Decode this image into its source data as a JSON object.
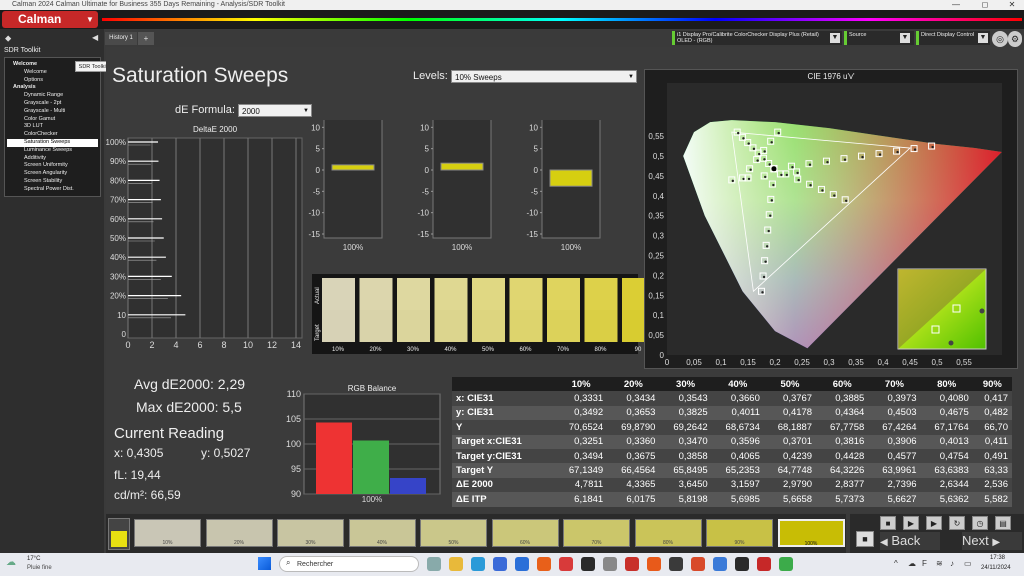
{
  "window": {
    "title": "Calman 2024 Calman Ultimate for Business 355 Days Remaining - Analysis/SDR Toolkit",
    "minimize": "—",
    "maximize": "◻",
    "close": "✕"
  },
  "app": {
    "logo": "Calman"
  },
  "sidebar": {
    "title": "SDR Toolkit",
    "tooltip": "SDR Toolkit",
    "items": [
      {
        "label": "Welcome",
        "level": 0
      },
      {
        "label": "Welcome",
        "level": 1
      },
      {
        "label": "Options",
        "level": 1
      },
      {
        "label": "Analysis",
        "level": 0
      },
      {
        "label": "Dynamic Range",
        "level": 1
      },
      {
        "label": "Grayscale - 2pt",
        "level": 1
      },
      {
        "label": "Grayscale - Multi",
        "level": 1
      },
      {
        "label": "Color Gamut",
        "level": 1
      },
      {
        "label": "3D LUT",
        "level": 1
      },
      {
        "label": "ColorChecker",
        "level": 1
      },
      {
        "label": "Saturation Sweeps",
        "level": 1,
        "selected": true
      },
      {
        "label": "Luminance Sweeps",
        "level": 1
      },
      {
        "label": "Additivity",
        "level": 1
      },
      {
        "label": "Screen Uniformity",
        "level": 1
      },
      {
        "label": "Screen Angularity",
        "level": 1
      },
      {
        "label": "Screen Stability",
        "level": 1
      },
      {
        "label": "Spectral Power Dist.",
        "level": 1
      }
    ]
  },
  "tabs": {
    "history": "History 1",
    "add": "+"
  },
  "devices": {
    "meter_line1": "i1 Display Pro/Calibrite ColorChecker Display Plus (Retail)",
    "meter_line2": "OLED - (RGB)",
    "source": "Source",
    "display": "Direct Display Control"
  },
  "page": {
    "title": "Saturation Sweeps",
    "levels_label": "Levels:",
    "levels_value": "10% Sweeps",
    "formula_label": "dE Formula:",
    "formula_value": "2000"
  },
  "deltaE_chart": {
    "title": "DeltaE 2000",
    "y_ticks": [
      "0",
      "10",
      "20%",
      "30%",
      "40%",
      "50%",
      "60%",
      "70%",
      "80%",
      "90%",
      "100%"
    ],
    "x_ticks": [
      "0",
      "2",
      "4",
      "6",
      "8",
      "10",
      "12",
      "14"
    ],
    "values": [
      0,
      4.78,
      4.43,
      3.65,
      3.16,
      2.98,
      2.84,
      2.74,
      2.63,
      2.54,
      2.5
    ]
  },
  "delta_charts": {
    "y_ticks": [
      "15",
      "10",
      "5",
      "0",
      "-5",
      "-10",
      "-15"
    ],
    "footer": "100%",
    "items": [
      {
        "title": "Delta L",
        "value": 1.2
      },
      {
        "title": "Delta C",
        "value": 1.6
      },
      {
        "title": "Delta H",
        "value": -3.8
      }
    ]
  },
  "swatch_grid": {
    "actual_label": "Actual",
    "target_label": "Target",
    "labels": [
      "10%",
      "20%",
      "30%",
      "40%",
      "50%",
      "60%",
      "70%",
      "80%",
      "90"
    ],
    "actual_colors": [
      "#d9d4b8",
      "#dcd6ad",
      "#ded8a0",
      "#dfd892",
      "#e0d883",
      "#e0d671",
      "#dfd45e",
      "#ddd14a",
      "#dbce34"
    ],
    "target_colors": [
      "#d7d2b6",
      "#d9d3aa",
      "#dbd59c",
      "#dcd58e",
      "#ddd57f",
      "#ddd46d",
      "#dcd25a",
      "#dacf45",
      "#d8cc30"
    ]
  },
  "stats": {
    "avg": "Avg dE2000: 2,29",
    "max": "Max dE2000: 5,5",
    "current_title": "Current Reading",
    "x": "x: 0,4305",
    "y": "y: 0,5027",
    "fl": "fL: 19,44",
    "cdm": "cd/m²: 66,59"
  },
  "rgb_balance": {
    "title": "RGB Balance",
    "y_ticks": [
      "110",
      "105",
      "100",
      "95",
      "90"
    ],
    "ylim": [
      90,
      110
    ],
    "footer": "100%",
    "values": [
      {
        "name": "R",
        "value": 104.3,
        "color": "#ee3333"
      },
      {
        "name": "G",
        "value": 100.7,
        "color": "#3fae49"
      },
      {
        "name": "B",
        "value": 93.2,
        "color": "#3644c8"
      }
    ]
  },
  "cie": {
    "title": "CIE 1976 u'v'",
    "y_ticks": [
      "0,55",
      "0,5",
      "0,45",
      "0,4",
      "0,35",
      "0,3",
      "0,25",
      "0,2",
      "0,15",
      "0,1",
      "0,05",
      "0"
    ],
    "x_ticks": [
      "0",
      "0,05",
      "0,1",
      "0,15",
      "0,2",
      "0,25",
      "0,3",
      "0,35",
      "0,4",
      "0,45",
      "0,5",
      "0,55"
    ]
  },
  "table": {
    "columns": [
      "10%",
      "20%",
      "30%",
      "40%",
      "50%",
      "60%",
      "70%",
      "80%",
      "90%"
    ],
    "rows": [
      {
        "label": "x: CIE31",
        "values": [
          "0,3331",
          "0,3434",
          "0,3543",
          "0,3660",
          "0,3767",
          "0,3885",
          "0,3973",
          "0,4080",
          "0,417"
        ]
      },
      {
        "label": "y: CIE31",
        "values": [
          "0,3492",
          "0,3653",
          "0,3825",
          "0,4011",
          "0,4178",
          "0,4364",
          "0,4503",
          "0,4675",
          "0,482"
        ]
      },
      {
        "label": "Y",
        "values": [
          "70,6524",
          "69,8790",
          "69,2642",
          "68,6734",
          "68,1887",
          "67,7758",
          "67,4264",
          "67,1764",
          "66,70"
        ]
      },
      {
        "label": "Target x:CIE31",
        "values": [
          "0,3251",
          "0,3360",
          "0,3470",
          "0,3596",
          "0,3701",
          "0,3816",
          "0,3906",
          "0,4013",
          "0,411"
        ]
      },
      {
        "label": "Target y:CIE31",
        "values": [
          "0,3494",
          "0,3675",
          "0,3858",
          "0,4065",
          "0,4239",
          "0,4428",
          "0,4577",
          "0,4754",
          "0,491"
        ]
      },
      {
        "label": "Target Y",
        "values": [
          "67,1349",
          "66,4564",
          "65,8495",
          "65,2353",
          "64,7748",
          "64,3226",
          "63,9961",
          "63,6383",
          "63,33"
        ]
      },
      {
        "label": "ΔE 2000",
        "values": [
          "4,7811",
          "4,3365",
          "3,6450",
          "3,1597",
          "2,9790",
          "2,8377",
          "2,7396",
          "2,6344",
          "2,536"
        ]
      },
      {
        "label": "ΔE ITP",
        "values": [
          "6,1841",
          "6,0175",
          "5,8198",
          "5,6985",
          "5,6658",
          "5,7373",
          "5,6627",
          "5,6362",
          "5,582"
        ]
      }
    ]
  },
  "bottom": {
    "labels": [
      "10%",
      "20%",
      "30%",
      "40%",
      "50%",
      "60%",
      "70%",
      "80%",
      "90%",
      "100%"
    ],
    "colors": [
      "#c9c6b6",
      "#c8c5ae",
      "#c8c5a2",
      "#c9c697",
      "#cac78a",
      "#cbc77a",
      "#cbc66a",
      "#cac459",
      "#c8c146",
      "#c8bd05"
    ],
    "current_color": "#e8e012",
    "back": "Back",
    "next": "Next"
  },
  "taskbar": {
    "weather_temp": "17°C",
    "weather_desc": "Pluie fine",
    "search": "Rechercher",
    "time": "17:38",
    "date": "24/11/2024"
  }
}
